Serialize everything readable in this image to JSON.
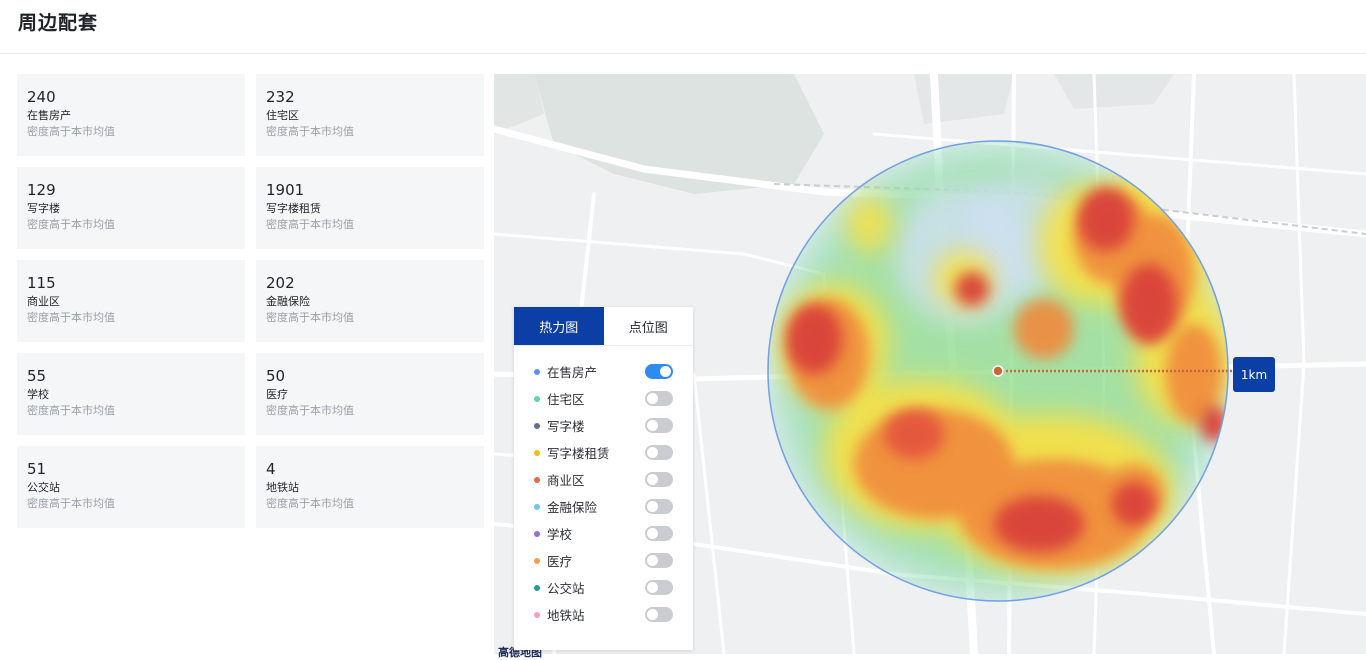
{
  "page": {
    "title": "周边配套"
  },
  "stats": [
    {
      "count": "240",
      "name": "在售房产",
      "desc": "密度高于本市均值"
    },
    {
      "count": "232",
      "name": "住宅区",
      "desc": "密度高于本市均值"
    },
    {
      "count": "129",
      "name": "写字楼",
      "desc": "密度高于本市均值"
    },
    {
      "count": "1901",
      "name": "写字楼租赁",
      "desc": "密度高于本市均值"
    },
    {
      "count": "115",
      "name": "商业区",
      "desc": "密度高于本市均值"
    },
    {
      "count": "202",
      "name": "金融保险",
      "desc": "密度高于本市均值"
    },
    {
      "count": "55",
      "name": "学校",
      "desc": "密度高于本市均值"
    },
    {
      "count": "50",
      "name": "医疗",
      "desc": "密度高于本市均值"
    },
    {
      "count": "51",
      "name": "公交站",
      "desc": "密度高于本市均值"
    },
    {
      "count": "4",
      "name": "地铁站",
      "desc": "密度高于本市均值"
    }
  ],
  "map_panel": {
    "tabs": [
      {
        "label": "热力图",
        "active": true
      },
      {
        "label": "点位图",
        "active": false
      }
    ],
    "layers": [
      {
        "label": "在售房产",
        "color": "#5b8ff9",
        "enabled": true
      },
      {
        "label": "住宅区",
        "color": "#5ad8a6",
        "enabled": false
      },
      {
        "label": "写字楼",
        "color": "#5d7092",
        "enabled": false
      },
      {
        "label": "写字楼租赁",
        "color": "#f6bd16",
        "enabled": false
      },
      {
        "label": "商业区",
        "color": "#e8684a",
        "enabled": false
      },
      {
        "label": "金融保险",
        "color": "#6dc8ec",
        "enabled": false
      },
      {
        "label": "学校",
        "color": "#9270ca",
        "enabled": false
      },
      {
        "label": "医疗",
        "color": "#ff9d4d",
        "enabled": false
      },
      {
        "label": "公交站",
        "color": "#269a99",
        "enabled": false
      },
      {
        "label": "地铁站",
        "color": "#ff99c3",
        "enabled": false
      }
    ]
  },
  "map": {
    "radius_label": "1km",
    "attribution": "高德地图",
    "accent_color": "#0b3fa5"
  }
}
